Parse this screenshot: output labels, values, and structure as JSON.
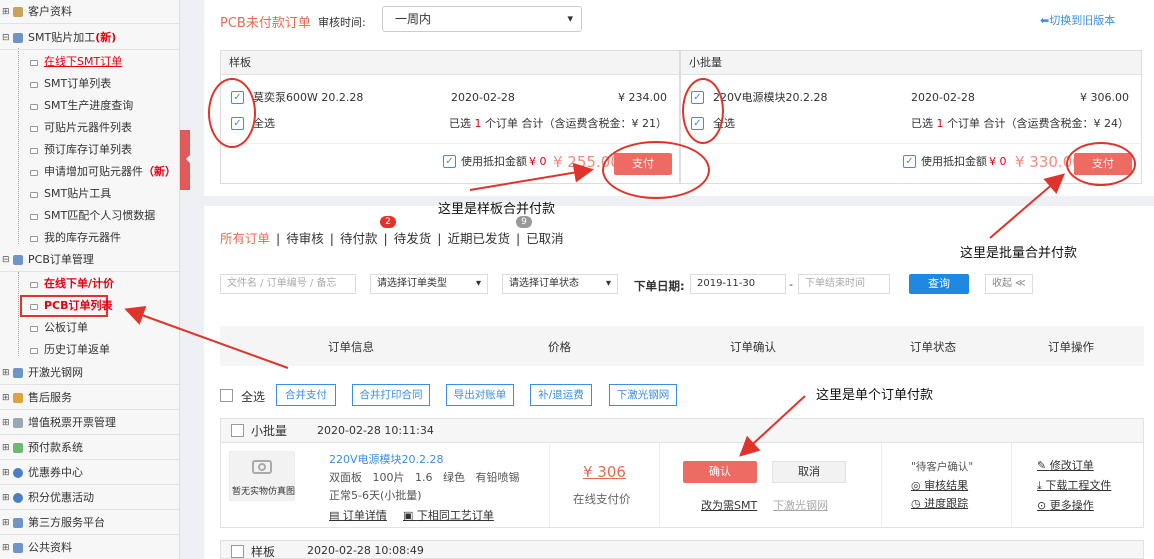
{
  "sidebar": {
    "customer_info": "客户资料",
    "smt": {
      "label": "SMT贴片加工",
      "tag": "(新)"
    },
    "smt_items": [
      "在线下SMT订单",
      "SMT订单列表",
      "SMT生产进度查询",
      "可贴片元器件列表",
      "预订库存订单列表"
    ],
    "smt_apply": {
      "label": "申请增加可贴元器件",
      "tag": "（新）"
    },
    "smt_items2": [
      "SMT贴片工具",
      "SMT匹配个人习惯数据",
      "我的库存元器件"
    ],
    "pcb": "PCB订单管理",
    "pcb_items": [
      "在线下单/计价",
      "PCB订单列表",
      "公板订单",
      "历史订单返单"
    ],
    "groups": [
      "开激光钢网",
      "售后服务",
      "增值税票开票管理",
      "预付款系统",
      "优惠券中心",
      "积分优惠活动",
      "第三方服务平台",
      "公共资料"
    ]
  },
  "top": {
    "title": "PCB未付款订单",
    "review_label": "审核时间:",
    "review_value": "一周内",
    "switch_old": "切换到旧版本",
    "sample": {
      "header": "样板",
      "item_name": "莫奕泵600W 20.2.28",
      "item_date": "2020-02-28",
      "item_price": "¥ 234.00",
      "select_all": "全选",
      "summary_pre": "已选",
      "summary_count": "1",
      "summary_post": "个订单 合计（含运费含税金：¥ 21）",
      "use_credit": "使用抵扣金额",
      "credit_amount": "¥ 0",
      "total": "¥ 255.00",
      "pay": "支付"
    },
    "batch": {
      "header": "小批量",
      "item_name": "220V电源模块20.2.28",
      "item_date": "2020-02-28",
      "item_price": "¥ 306.00",
      "select_all": "全选",
      "summary_pre": "已选",
      "summary_count": "1",
      "summary_post": "个订单 合计（含运费含税金：¥ 24）",
      "use_credit": "使用抵扣金额",
      "credit_amount": "¥ 0",
      "total": "¥ 330.00",
      "pay": "支付"
    }
  },
  "annotations": {
    "sample_merge": "这里是样板合并付款",
    "batch_merge": "这里是批量合并付款",
    "single_order": "这里是单个订单付款"
  },
  "orders": {
    "tabs": [
      "所有订单",
      "待审核",
      "待付款",
      "待发货",
      "近期已发货",
      "已取消"
    ],
    "badges": {
      "pending_payment": "2",
      "recently_shipped": "9"
    },
    "filters": {
      "keyword_placeholder": "文件名 / 订单编号 / 备忘",
      "type": "请选择订单类型",
      "status": "请选择订单状态",
      "date_label": "下单日期:",
      "date_start": "2019-11-30",
      "date_end_placeholder": "下单结束时间",
      "query": "查询",
      "collapse": "收起 ≪"
    },
    "columns": [
      "订单信息",
      "价格",
      "订单确认",
      "订单状态",
      "订单操作"
    ],
    "select_all": "全选",
    "actions": [
      "合并支付",
      "合并打印合同",
      "导出对账单",
      "补/退运费",
      "下激光钢网"
    ],
    "order1": {
      "type": "小批量",
      "datetime": "2020-02-28 10:11:34",
      "thumb_text": "暂无实物仿真图",
      "name": "220V电源模块20.2.28",
      "specs": "双面板   100片   1.6   绿色   有铅喷锡",
      "lead_time": "正常5-6天(小批量)",
      "detail": "订单详情",
      "same_process": "下相同工艺订单",
      "price": "¥ 306",
      "price_note": "在线支付价",
      "confirm": "确认",
      "cancel": "取消",
      "change_smt": "改为需SMT",
      "stencil": "下激光钢网",
      "status": "\"待客户确认\"",
      "audit_result": "审核结果",
      "progress": "进度跟踪",
      "modify": "修改订单",
      "download": "下载工程文件",
      "more": "更多操作"
    },
    "order2": {
      "type": "样板",
      "datetime": "2020-02-28 10:08:49"
    }
  }
}
